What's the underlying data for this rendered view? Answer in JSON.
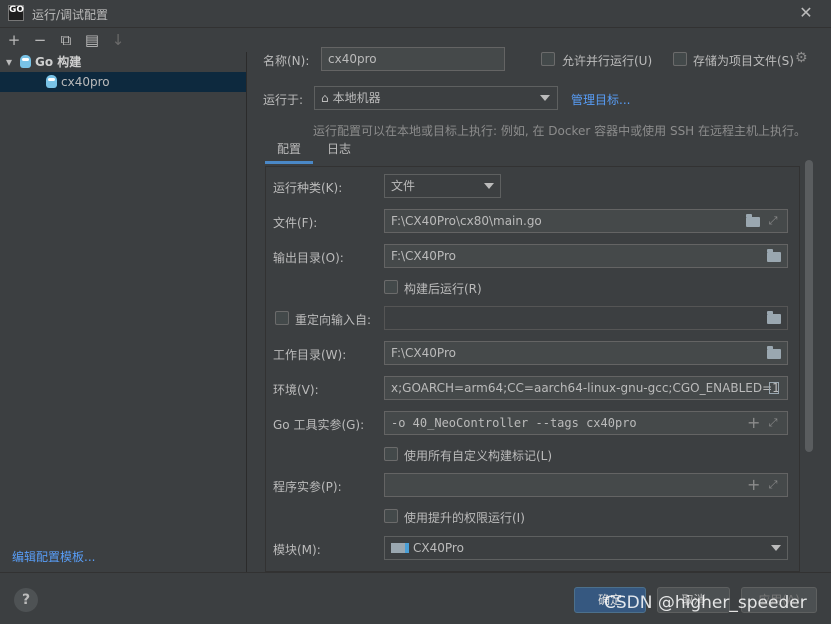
{
  "window": {
    "app_icon_text": "GO",
    "title": "运行/调试配置",
    "close_glyph": "✕"
  },
  "toolbar": {
    "add": "+",
    "remove": "−",
    "copy": "⧉",
    "new_folder": "▤",
    "sort": "↓"
  },
  "tree": {
    "group_arrow": "▾",
    "group_label": "Go 构建",
    "items": [
      {
        "label": "cx40pro"
      }
    ]
  },
  "edit_templates": "编辑配置模板...",
  "header": {
    "name_label": "名称(N):",
    "name_value": "cx40pro",
    "allow_parallel": "允许并行运行(U)",
    "store_as_project": "存储为项目文件(S)",
    "gear": "⚙",
    "run_on_label": "运行于:",
    "run_on_value": "本地机器",
    "home_glyph": "⌂",
    "manage_targets": "管理目标...",
    "hint": "运行配置可以在本地或目标上执行: 例如, 在 Docker 容器中或使用 SSH 在远程主机上执行。"
  },
  "tabs": [
    {
      "label": "配置"
    },
    {
      "label": "日志"
    }
  ],
  "form": {
    "run_kind_label": "运行种类(K):",
    "run_kind_value": "文件",
    "file_label": "文件(F):",
    "file_value": "F:\\CX40Pro\\cx80\\main.go",
    "output_dir_label": "输出目录(O):",
    "output_dir_value": "F:\\CX40Pro",
    "run_after_build": "构建后运行(R)",
    "redirect_input_label": "重定向输入自:",
    "redirect_input_value": "",
    "workdir_label": "工作目录(W):",
    "workdir_value": "F:\\CX40Pro",
    "env_label": "环境(V):",
    "env_value": "x;GOARCH=arm64;CC=aarch64-linux-gnu-gcc;CGO_ENABLED=1",
    "go_tool_args_label": "Go 工具实参(G):",
    "go_tool_args_value": "-o 40_NeoController --tags cx40pro",
    "use_custom_tags": "使用所有自定义构建标记(L)",
    "program_args_label": "程序实参(P):",
    "program_args_value": "",
    "run_elevated": "使用提升的权限运行(I)",
    "module_label": "模块(M):",
    "module_value": "CX40Pro",
    "expand_glyph": "⤢",
    "plus_glyph": "+"
  },
  "footer": {
    "help": "?",
    "ok": "确定",
    "cancel": "取消",
    "apply": "应用(A)"
  },
  "watermark": "CSDN @higher_speeder"
}
